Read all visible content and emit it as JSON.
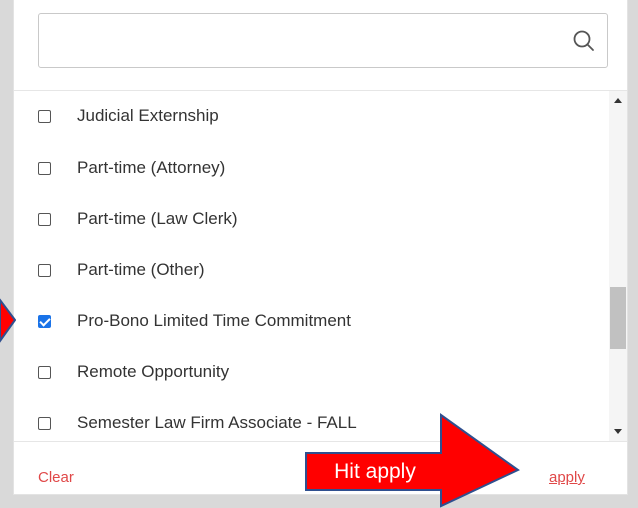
{
  "search": {
    "value": "",
    "placeholder": "",
    "icon": "search-icon"
  },
  "filters": {
    "items": [
      {
        "label": "Judicial Externship",
        "checked": false
      },
      {
        "label": "Part-time (Attorney)",
        "checked": false
      },
      {
        "label": "Part-time (Law Clerk)",
        "checked": false
      },
      {
        "label": "Part-time (Other)",
        "checked": false
      },
      {
        "label": "Pro-Bono Limited Time Commitment",
        "checked": true
      },
      {
        "label": "Remote Opportunity",
        "checked": false
      },
      {
        "label": "Semester Law Firm Associate - FALL",
        "checked": false
      }
    ]
  },
  "footer": {
    "clear_label": "Clear",
    "apply_label": "apply"
  },
  "annotation": {
    "callout_text": "Hit apply",
    "callout_color": "#ff0000",
    "arrow_border_color": "#2f4f8f"
  },
  "colors": {
    "link": "#e04848",
    "checkbox_checked": "#1a73e8",
    "text": "#333333"
  }
}
